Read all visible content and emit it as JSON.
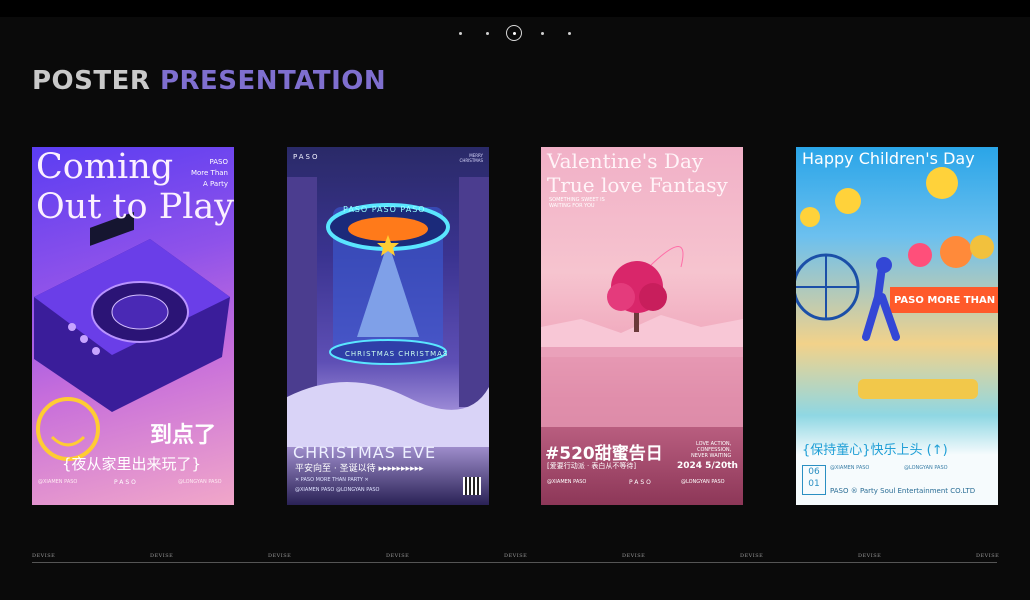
{
  "header": {
    "title_word1": "POSTER",
    "title_word2": "PRESENTATION",
    "pager_count": 5,
    "pager_active_index": 2
  },
  "posters": [
    {
      "headline": "Coming\nOut to Play",
      "brand_side": "PASO\nMore Than\nA Party",
      "cn_line1": "到点了",
      "cn_line2": "{夜从家里出来玩了}",
      "logo": "PASO",
      "footer_left": "@XIAMEN PASO",
      "footer_right": "@LONGYAN PASO"
    },
    {
      "logo": "PASO",
      "side_text": "MERRY\nCHRISTMAS",
      "ring_label": "PASO PASO PASO",
      "ring_label_bottom": "CHRISTMAS CHRISTMAS",
      "headline": "CHRISTMAS EVE",
      "cn_line": "平安向至 · 圣诞以待 ▸▸▸▸▸▸▸▸▸▸",
      "sub_line": "✕ PASO MORE THAN PARTY ✕",
      "footer_left": "@XIAMEN PASO   @LONGYAN PASO"
    },
    {
      "headline": "Valentine's Day\nTrue love Fantasy",
      "sub_text": "SOMETHING SWEET IS\nWAITING FOR YOU",
      "cn_line": "#520甜蜜告日",
      "cn_sub": "[爱要行动派 · 表白从不等待]",
      "side_text": "LOVE ACTION,\nCONFESSION,\nNEVER WAITING",
      "date": "2024 5/20th",
      "logo": "PASO",
      "footer_left": "@XIAMEN PASO",
      "footer_right": "@LONGYAN PASO"
    },
    {
      "headline": "Happy Children's Day",
      "banner": "PASO MORE THAN",
      "cn_line": "{保持童心}快乐上头 (↑)",
      "date_box": "06\n01",
      "footer_left": "@XIAMEN PASO",
      "footer_right": "@LONGYAN PASO",
      "company": "PASO ® Party Soul Entertainment CO.LTD"
    }
  ],
  "footer": {
    "labels": [
      "DEVISE",
      "DEVISE",
      "DEVISE",
      "DEVISE",
      "DEVISE",
      "DEVISE",
      "DEVISE",
      "DEVISE",
      "DEVISE"
    ]
  }
}
